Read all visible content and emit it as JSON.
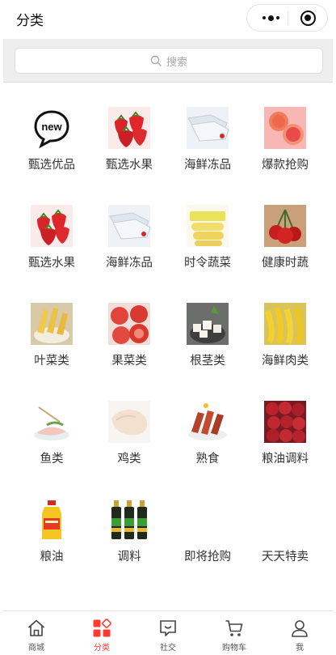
{
  "nav": {
    "title": "分类"
  },
  "search": {
    "placeholder": "搜索"
  },
  "categories": [
    {
      "label": "甄选优品",
      "icon": "new-badge-icon"
    },
    {
      "label": "甄选水果",
      "icon": "strawberry-image"
    },
    {
      "label": "海鲜冻品",
      "icon": "frozen-fish-image"
    },
    {
      "label": "爆款抢购",
      "icon": "grapefruit-image"
    },
    {
      "label": "甄选水果",
      "icon": "strawberry-image"
    },
    {
      "label": "海鲜冻品",
      "icon": "frozen-fish-image"
    },
    {
      "label": "时令蔬菜",
      "icon": "corn-image"
    },
    {
      "label": "健康时蔬",
      "icon": "cherry-image"
    },
    {
      "label": "叶菜类",
      "icon": "corn-basket-image"
    },
    {
      "label": "果菜类",
      "icon": "tomato-image"
    },
    {
      "label": "根茎类",
      "icon": "root-vegetable-image"
    },
    {
      "label": "海鲜肉类",
      "icon": "banana-image"
    },
    {
      "label": "鱼类",
      "icon": "fish-slice-image"
    },
    {
      "label": "鸡类",
      "icon": "chicken-image"
    },
    {
      "label": "熟食",
      "icon": "cooked-meat-image"
    },
    {
      "label": "粮油调料",
      "icon": "lychee-image"
    },
    {
      "label": "粮油",
      "icon": "oil-bottle-image"
    },
    {
      "label": "调料",
      "icon": "sauce-bottles-image"
    },
    {
      "label": "即将抢购",
      "icon": ""
    },
    {
      "label": "天天特卖",
      "icon": ""
    }
  ],
  "tabbar": [
    {
      "label": "商城",
      "icon": "home-icon"
    },
    {
      "label": "分类",
      "icon": "category-icon",
      "active": true
    },
    {
      "label": "社交",
      "icon": "chat-icon"
    },
    {
      "label": "购物车",
      "icon": "cart-icon"
    },
    {
      "label": "我",
      "icon": "user-icon"
    }
  ],
  "colors": {
    "accent": "#ff3b30",
    "search_bg": "#eeeeee"
  }
}
